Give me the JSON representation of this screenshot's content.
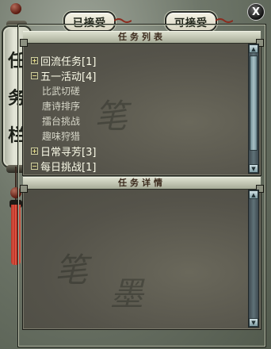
{
  "tabs": {
    "accepted_label": "已接受",
    "available_label": "可接受"
  },
  "close_label": "X",
  "banner": {
    "chars": [
      "任",
      "务",
      "栏"
    ]
  },
  "quest_list": {
    "title": "任务列表",
    "items": [
      {
        "type": "category",
        "toggle": "+",
        "label": "回流任务[1]"
      },
      {
        "type": "category",
        "toggle": "−",
        "label": "五一活动[4]"
      },
      {
        "type": "child",
        "label": "比武切磋"
      },
      {
        "type": "child",
        "label": "唐诗排序"
      },
      {
        "type": "child",
        "label": "擂台挑战"
      },
      {
        "type": "child",
        "label": "趣味狩猎"
      },
      {
        "type": "category",
        "toggle": "+",
        "label": "日常寻芳[3]"
      },
      {
        "type": "category",
        "toggle": "−",
        "label": "每日挑战[1]"
      }
    ]
  },
  "details": {
    "title": "任务详情"
  },
  "scroll_arrows": {
    "up": "▲",
    "down": "▼"
  },
  "colors": {
    "accent_tassel": "#c0392b",
    "panel_bg": "#58564a",
    "category_text": "#fbfbe8"
  }
}
